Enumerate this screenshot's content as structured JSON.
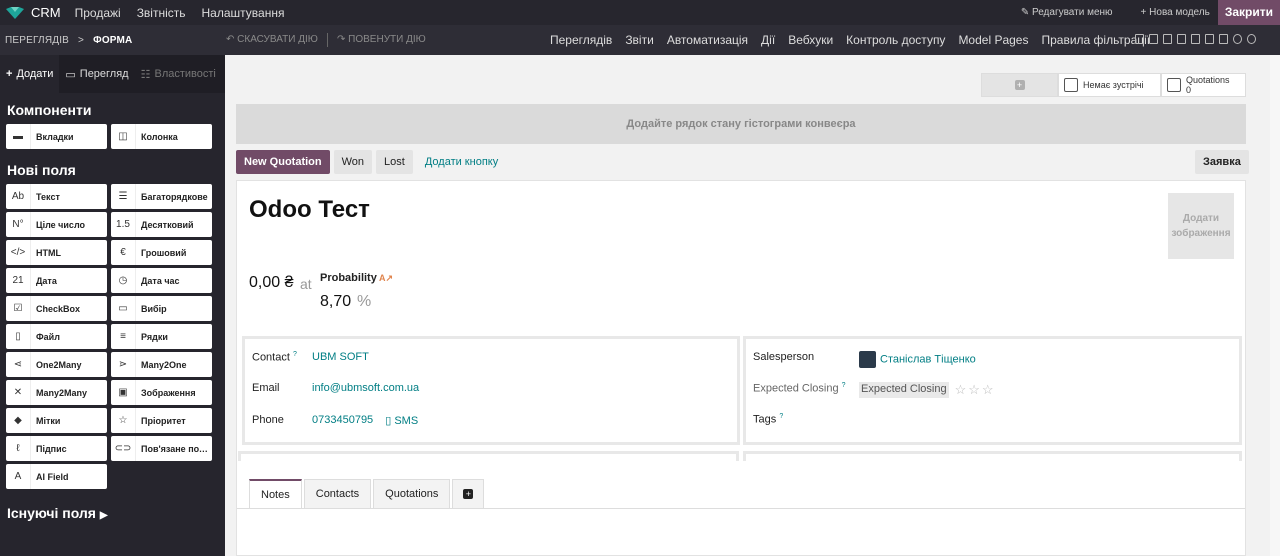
{
  "topbar": {
    "app": "CRM",
    "menus": [
      "Продажі",
      "Звітність",
      "Налаштування"
    ],
    "edit_menu": "Редагувати меню",
    "new_model": "Нова модель",
    "close": "Закрити"
  },
  "secbar": {
    "crumb_parent": "ПЕРЕГЛЯДІВ",
    "crumb_sep": ">",
    "crumb_current": "ФОРМА",
    "undo": "СКАСУВАТИ ДІЮ",
    "redo": "ПОВЕНУТИ ДІЮ",
    "views": [
      "Переглядів",
      "Звіти",
      "Автоматизація",
      "Дії",
      "Вебхуки",
      "Контроль доступу",
      "Model Pages",
      "Правила фільтрації"
    ]
  },
  "sidebar": {
    "tabs": [
      "Додати",
      "Перегляд",
      "Властивості"
    ],
    "components_title": "Компоненти",
    "components": [
      {
        "icon": "tabs-icon",
        "glyph": "▬",
        "label": "Вкладки"
      },
      {
        "icon": "column-icon",
        "glyph": "◫",
        "label": "Колонка"
      }
    ],
    "new_fields_title": "Нові поля",
    "fields": [
      {
        "icon": "text-icon",
        "glyph": "Ab",
        "label": "Текст"
      },
      {
        "icon": "multiline-icon",
        "glyph": "☰",
        "label": "Багаторядкове"
      },
      {
        "icon": "integer-icon",
        "glyph": "N°",
        "label": "Ціле число"
      },
      {
        "icon": "decimal-icon",
        "glyph": "1.5",
        "label": "Десятковий"
      },
      {
        "icon": "html-icon",
        "glyph": "</>",
        "label": "HTML"
      },
      {
        "icon": "monetary-icon",
        "glyph": "€",
        "label": "Грошовий"
      },
      {
        "icon": "date-icon",
        "glyph": "21",
        "label": "Дата"
      },
      {
        "icon": "datetime-icon",
        "glyph": "◷",
        "label": "Дата час"
      },
      {
        "icon": "checkbox-icon",
        "glyph": "☑",
        "label": "CheckBox"
      },
      {
        "icon": "selection-icon",
        "glyph": "▭",
        "label": "Вибір"
      },
      {
        "icon": "file-icon",
        "glyph": "▯",
        "label": "Файл"
      },
      {
        "icon": "lines-icon",
        "glyph": "≡",
        "label": "Рядки"
      },
      {
        "icon": "one2many-icon",
        "glyph": "⋖",
        "label": "One2Many"
      },
      {
        "icon": "many2one-icon",
        "glyph": "⋗",
        "label": "Many2One"
      },
      {
        "icon": "many2many-icon",
        "glyph": "✕",
        "label": "Many2Many"
      },
      {
        "icon": "image-icon",
        "glyph": "▣",
        "label": "Зображення"
      },
      {
        "icon": "tags-icon",
        "glyph": "◆",
        "label": "Мітки"
      },
      {
        "icon": "priority-icon",
        "glyph": "☆",
        "label": "Пріоритет"
      },
      {
        "icon": "signature-icon",
        "glyph": "ℓ",
        "label": "Підпис"
      },
      {
        "icon": "related-icon",
        "glyph": "⊂⊃",
        "label": "Пов'язане поле"
      },
      {
        "icon": "ai-icon",
        "glyph": "A",
        "label": "AI Field"
      }
    ],
    "existing_title": "Існуючі поля"
  },
  "smart": {
    "meetings": "Немає зустрічі",
    "quotations_label": "Quotations",
    "quotations_count": "0"
  },
  "pipeline": "Додайте рядок стану гістограми конвеєра",
  "actions": {
    "new_quotation": "New Quotation",
    "won": "Won",
    "lost": "Lost",
    "add_button": "Додати кнопку",
    "context": "Заявка"
  },
  "record": {
    "name": "Odoo Тест",
    "add_image": "Додати зображення",
    "revenue": "0,00 ₴",
    "at": "at",
    "probability_label": "Probability",
    "probability_value": "8,70",
    "percent": "%"
  },
  "left_group": {
    "contact_label": "Contact",
    "contact_value": "UBM SOFT",
    "email_label": "Email",
    "email_value": "info@ubmsoft.com.ua",
    "phone_label": "Phone",
    "phone_value": "0733450795",
    "sms": "SMS"
  },
  "right_group": {
    "salesperson_label": "Salesperson",
    "salesperson_value": "Станіслав Тіщенко",
    "closing_label": "Expected Closing",
    "closing_value": "Expected Closing",
    "tags_label": "Tags"
  },
  "help_mark": "?",
  "tabs": [
    "Notes",
    "Contacts",
    "Quotations"
  ]
}
